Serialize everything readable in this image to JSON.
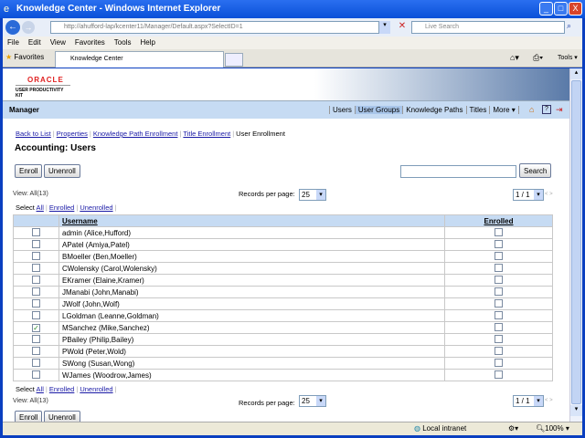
{
  "window": {
    "title": "Knowledge Center - Windows Internet Explorer",
    "minimize": "_",
    "maximize": "□",
    "close": "X"
  },
  "address": {
    "url": "http://ahufford-lap/kcenter11/Manager/Default.aspx?SelectID=1",
    "search_placeholder": "Live Search"
  },
  "menu": [
    "File",
    "Edit",
    "View",
    "Favorites",
    "Tools",
    "Help"
  ],
  "tabs": {
    "favorites": "Favorites",
    "active_tab": "Knowledge Center",
    "tools": "Tools"
  },
  "header": {
    "logo": "ORACLE",
    "logo_sub": "USER PRODUCTIVITY KIT",
    "section": "Manager",
    "nav": [
      "Users",
      "User Groups",
      "Knowledge Paths",
      "Titles",
      "More"
    ],
    "active_nav": "User Groups"
  },
  "subnav": [
    "Back to List",
    "Properties",
    "Knowledge Path Enrollment",
    "Title Enrollment",
    "User Enrollment"
  ],
  "page_title": "Accounting: Users",
  "buttons": {
    "enroll": "Enroll",
    "unenroll": "Unenroll",
    "search": "Search"
  },
  "search_value": "",
  "view_label": "View: All(13)",
  "records_label": "Records per page:",
  "records_value": "25",
  "page_value": "1 / 1",
  "pager_arrows": "< >",
  "select": {
    "label": "Select",
    "all": "All",
    "enrolled": "Enrolled",
    "unenrolled": "Unenrolled"
  },
  "table": {
    "headers": [
      "Username",
      "Enrolled"
    ],
    "rows": [
      {
        "name": "admin (Alice,Hufford)",
        "selected": false,
        "enrolled": false
      },
      {
        "name": "APatel (Amiya,Patel)",
        "selected": false,
        "enrolled": false
      },
      {
        "name": "BMoeller (Ben,Moeller)",
        "selected": false,
        "enrolled": false
      },
      {
        "name": "CWolensky (Carol,Wolensky)",
        "selected": false,
        "enrolled": false
      },
      {
        "name": "EKramer (Elaine,Kramer)",
        "selected": false,
        "enrolled": false
      },
      {
        "name": "JManabi (John,Manabi)",
        "selected": false,
        "enrolled": false
      },
      {
        "name": "JWolf (John,Wolf)",
        "selected": false,
        "enrolled": false
      },
      {
        "name": "LGoldman (Leanne,Goldman)",
        "selected": false,
        "enrolled": false
      },
      {
        "name": "MSanchez (Mike,Sanchez)",
        "selected": true,
        "enrolled": false
      },
      {
        "name": "PBailey (Philip,Bailey)",
        "selected": false,
        "enrolled": false
      },
      {
        "name": "PWold (Peter,Wold)",
        "selected": false,
        "enrolled": false
      },
      {
        "name": "SWong (Susan,Wong)",
        "selected": false,
        "enrolled": false
      },
      {
        "name": "WJames (Woodrow,James)",
        "selected": false,
        "enrolled": false
      }
    ]
  },
  "status": {
    "zone": "Local intranet",
    "zoom": "100%"
  }
}
